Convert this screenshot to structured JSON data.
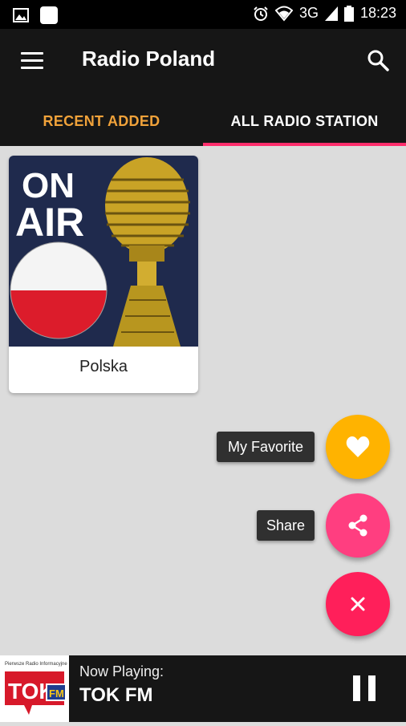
{
  "status_bar": {
    "network": "3G",
    "time": "18:23",
    "icons": [
      "image-icon",
      "app-icon",
      "alarm-icon",
      "wifi-icon",
      "signal-icon",
      "battery-icon"
    ]
  },
  "app_bar": {
    "title": "Radio Poland",
    "icons": [
      "menu-icon",
      "search-icon"
    ]
  },
  "tabs": [
    {
      "label": "RECENT ADDED",
      "color": "#f0a23a",
      "selected": false
    },
    {
      "label": "ALL RADIO STATION",
      "color": "#ffffff",
      "selected": true
    }
  ],
  "stations": [
    {
      "name": "Polska",
      "image_text": [
        "ON",
        "AIR"
      ]
    }
  ],
  "fab_menu": {
    "favorite_label": "My Favorite",
    "share_label": "Share",
    "colors": {
      "favorite": "#ffb300",
      "share": "#ff3e80",
      "close": "#ff1f5a"
    }
  },
  "player": {
    "now_playing_label": "Now Playing:",
    "station_name": "TOK FM",
    "logo_text": {
      "small": "Pierwsze Radio Informacyjne",
      "main": "TOK",
      "badge": "FM"
    }
  },
  "accent_color": "#ff2e6c"
}
